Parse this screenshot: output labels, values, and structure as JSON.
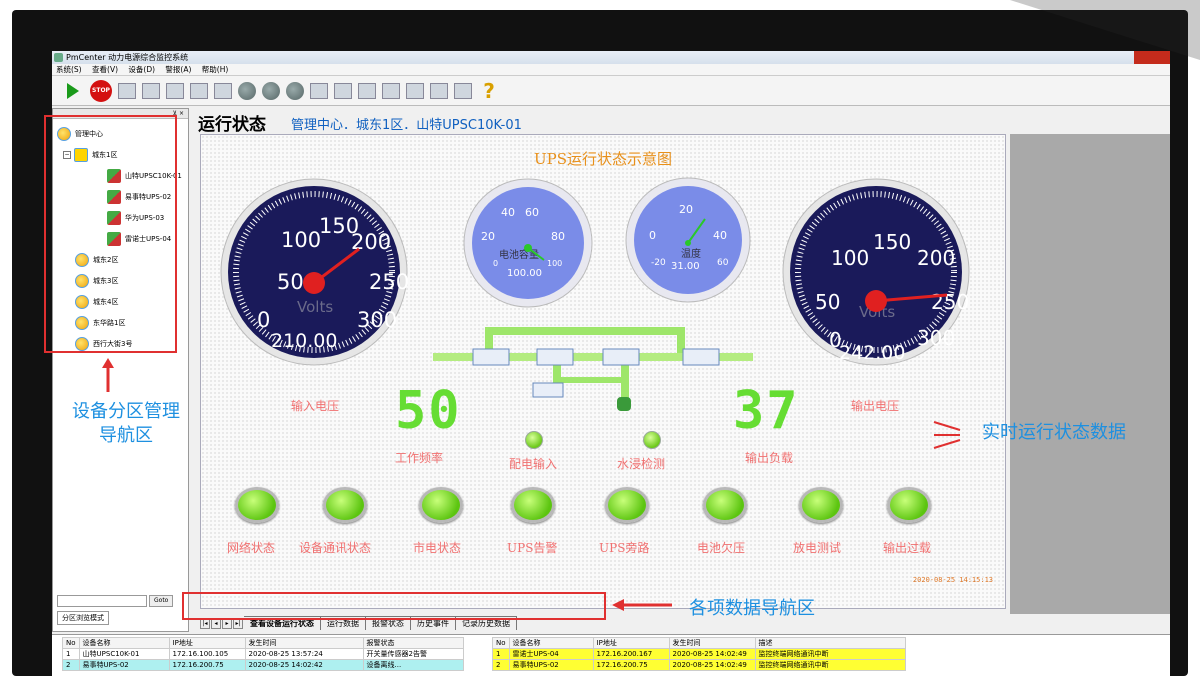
{
  "window": {
    "title": "PmCenter 动力电源综合监控系统"
  },
  "menu": [
    "系统(S)",
    "查看(V)",
    "设备(D)",
    "警报(A)",
    "帮助(H)"
  ],
  "toolbar": {
    "stop_label": "STOP"
  },
  "tree": {
    "root": "管理中心",
    "group1": "城东1区",
    "devices": [
      "山特UPSC10K-01",
      "易事特UPS-02",
      "华为UPS-03",
      "雷诺士UPS-04"
    ],
    "others": [
      "城东2区",
      "城东3区",
      "城东4区",
      "东华路1区",
      "西行大街3号"
    ]
  },
  "goto_label": "Goto",
  "mode_tab": "分区浏览模式",
  "page_title": "运行状态",
  "breadcrumb": "管理中心．城东1区．山特UPSC10K-01",
  "diagram": {
    "title": "UPS运行状态示意图",
    "input_voltage": {
      "label": "输入电压",
      "value": "210.00",
      "unit": "Volts",
      "ticks": [
        "0",
        "50",
        "100",
        "150",
        "200",
        "250",
        "300"
      ]
    },
    "output_voltage": {
      "label": "输出电压",
      "value": "242.00",
      "unit": "Volts",
      "ticks": [
        "0",
        "50",
        "100",
        "150",
        "200",
        "250",
        "300"
      ]
    },
    "battery": {
      "label": "电池容量",
      "value": "100.00",
      "ticks": [
        "0",
        "20",
        "40",
        "60",
        "80",
        "100"
      ]
    },
    "temperature": {
      "label": "温度",
      "value": "31.00",
      "ticks": [
        "-20",
        "0",
        "20",
        "40",
        "60"
      ]
    },
    "frequency": {
      "label": "工作频率",
      "value": "50"
    },
    "load": {
      "label": "输出负载",
      "value": "37"
    },
    "leds_small": [
      "配电输入",
      "水浸检测"
    ],
    "leds_big": [
      "网络状态",
      "设备通讯状态",
      "市电状态",
      "UPS告警",
      "UPS旁路",
      "电池欠压",
      "放电测试",
      "输出过载"
    ],
    "timestamp": "2020-08-25 14:15:13"
  },
  "tabs": [
    "查看设备运行状态",
    "运行数据",
    "报警状态",
    "历史事件",
    "记录历史数据"
  ],
  "annotations": {
    "left": "设备分区管理\n导航区",
    "right": "实时运行状态数据",
    "bottom": "各项数据导航区"
  },
  "table_left": {
    "headers": [
      "No",
      "设备名称",
      "IP地址",
      "发生时间",
      "报警状态"
    ],
    "rows": [
      [
        "1",
        "山特UPSC10K-01",
        "172.16.100.105",
        "2020-08-25 13:57:24",
        "开关量传感器2告警"
      ],
      [
        "2",
        "易事特UPS-02",
        "172.16.200.75",
        "2020-08-25 14:02:42",
        "设备离线..."
      ]
    ]
  },
  "table_right": {
    "headers": [
      "No",
      "设备名称",
      "IP地址",
      "发生时间",
      "描述"
    ],
    "rows": [
      [
        "1",
        "雷诺士UPS-04",
        "172.16.200.167",
        "2020-08-25 14:02:49",
        "监控终端网络通讯中断"
      ],
      [
        "2",
        "易事特UPS-02",
        "172.16.200.75",
        "2020-08-25 14:02:49",
        "监控终端网络通讯中断"
      ]
    ]
  },
  "colors": {
    "annotation_red": "#e03030",
    "annotation_blue": "#1e90e0",
    "led_green": "#66dd33",
    "gauge_navy": "#1a1a5a"
  }
}
